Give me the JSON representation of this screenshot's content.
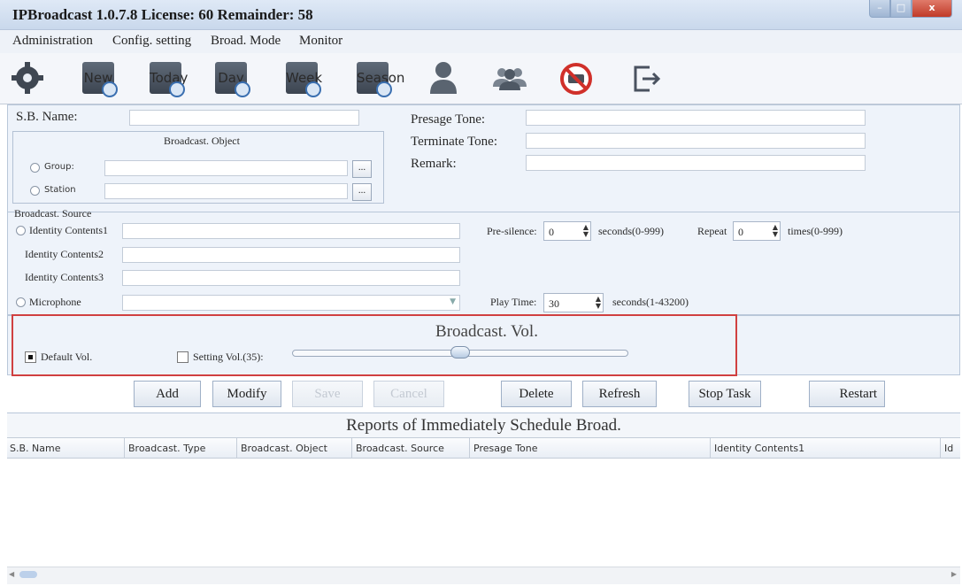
{
  "window": {
    "title": "IPBroadcast 1.0.7.8 License: 60 Remainder: 58",
    "close_glyph": "x"
  },
  "menu": [
    "Administration",
    "Config. setting",
    "Broad. Mode",
    "Monitor"
  ],
  "toolbar": {
    "icons": [
      "gear-icon",
      "new-calendar-icon",
      "today-calendar-icon",
      "day-calendar-icon",
      "week-calendar-icon",
      "season-calendar-icon",
      "user-icon",
      "group-icon",
      "mute-icon",
      "exit-icon"
    ],
    "cal_labels": [
      "New",
      "Today",
      "Day",
      "Week",
      "Season"
    ]
  },
  "form": {
    "sb_name_label": "S.B. Name:",
    "broadcast_object_label": "Broadcast. Object",
    "group_label": "Group:",
    "station_label": "Station",
    "browse": "...",
    "presage_tone_label": "Presage Tone:",
    "terminate_tone_label": "Terminate Tone:",
    "remark_label": "Remark:"
  },
  "source": {
    "title": "Broadcast. Source",
    "identity1": "Identity Contents1",
    "identity2": "Identity Contents2",
    "identity3": "Identity Contents3",
    "microphone": "Microphone",
    "pre_silence_label": "Pre-silence:",
    "pre_silence_value": "0",
    "pre_silence_unit": "seconds(0-999)",
    "repeat_label": "Repeat",
    "repeat_value": "0",
    "repeat_unit": "times(0-999)",
    "play_time_label": "Play Time:",
    "play_time_value": "30",
    "play_time_unit": "seconds(1-43200)"
  },
  "volume": {
    "title": "Broadcast. Vol.",
    "default_label": "Default Vol.",
    "setting_label": "Setting Vol.(35):",
    "default_checked": true,
    "setting_checked": false,
    "level": 0.5
  },
  "actions": [
    "Add",
    "Modify",
    "Save",
    "Cancel",
    "Delete",
    "Refresh",
    "Stop Task",
    "Restart"
  ],
  "report": {
    "title": "Reports of Immediately Schedule Broad.",
    "columns": [
      "S.B. Name",
      "Broadcast. Type",
      "Broadcast. Object",
      "Broadcast. Source",
      "Presage Tone",
      "Identity Contents1",
      "Id"
    ]
  }
}
